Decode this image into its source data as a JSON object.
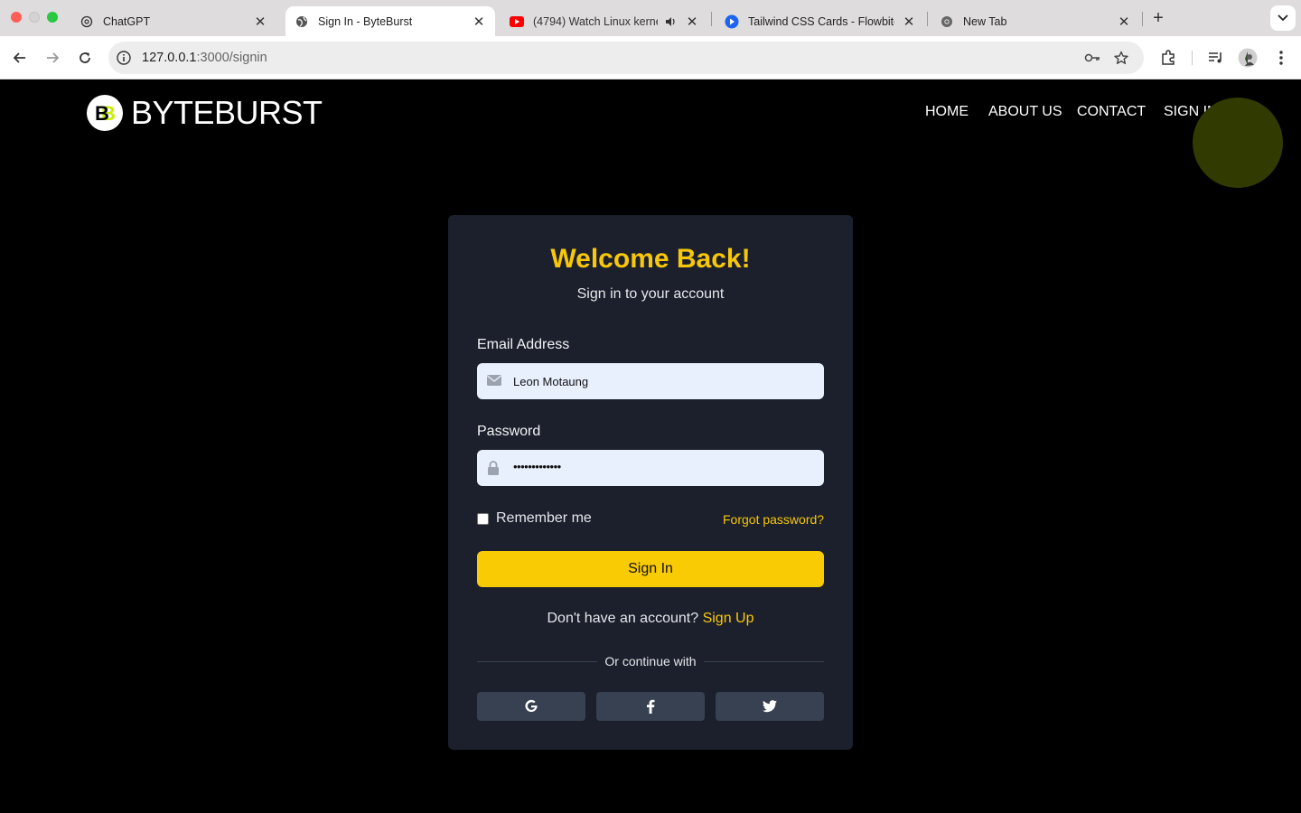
{
  "browser": {
    "tabs": [
      {
        "title": "ChatGPT",
        "icon": "chatgpt-icon",
        "active": false
      },
      {
        "title": "Sign In - ByteBurst",
        "icon": "globe-icon",
        "active": true
      },
      {
        "title": "(4794) Watch Linux kerne",
        "icon": "youtube-icon",
        "active": false,
        "audio": true
      },
      {
        "title": "Tailwind CSS Cards - Flowbite",
        "icon": "flowbite-icon",
        "active": false
      },
      {
        "title": "New Tab",
        "icon": "chrome-icon",
        "active": false
      }
    ],
    "url_host": "127.0.0.1",
    "url_path": ":3000/signin"
  },
  "site": {
    "logo_text": "BYTEBURST",
    "nav": [
      "HOME",
      "ABOUT US",
      "CONTACT",
      "SIGN IN"
    ]
  },
  "form": {
    "title": "Welcome Back!",
    "subtitle": "Sign in to your account",
    "email_label": "Email Address",
    "email_value": "Leon Motaung",
    "password_label": "Password",
    "password_value": "•••••••••••••",
    "remember_label": "Remember me",
    "remember_checked": false,
    "forgot_link": "Forgot password?",
    "submit_label": "Sign In",
    "no_account_text": "Don't have an account?",
    "signup_link": "Sign Up",
    "divider_text": "Or continue with",
    "social": [
      "google-icon",
      "facebook-icon",
      "twitter-icon"
    ]
  },
  "colors": {
    "accent": "#f8c708",
    "button": "#f9cb04",
    "card": "#1b202c",
    "input_bg": "#e8f0fe",
    "social_bg": "#374151"
  }
}
